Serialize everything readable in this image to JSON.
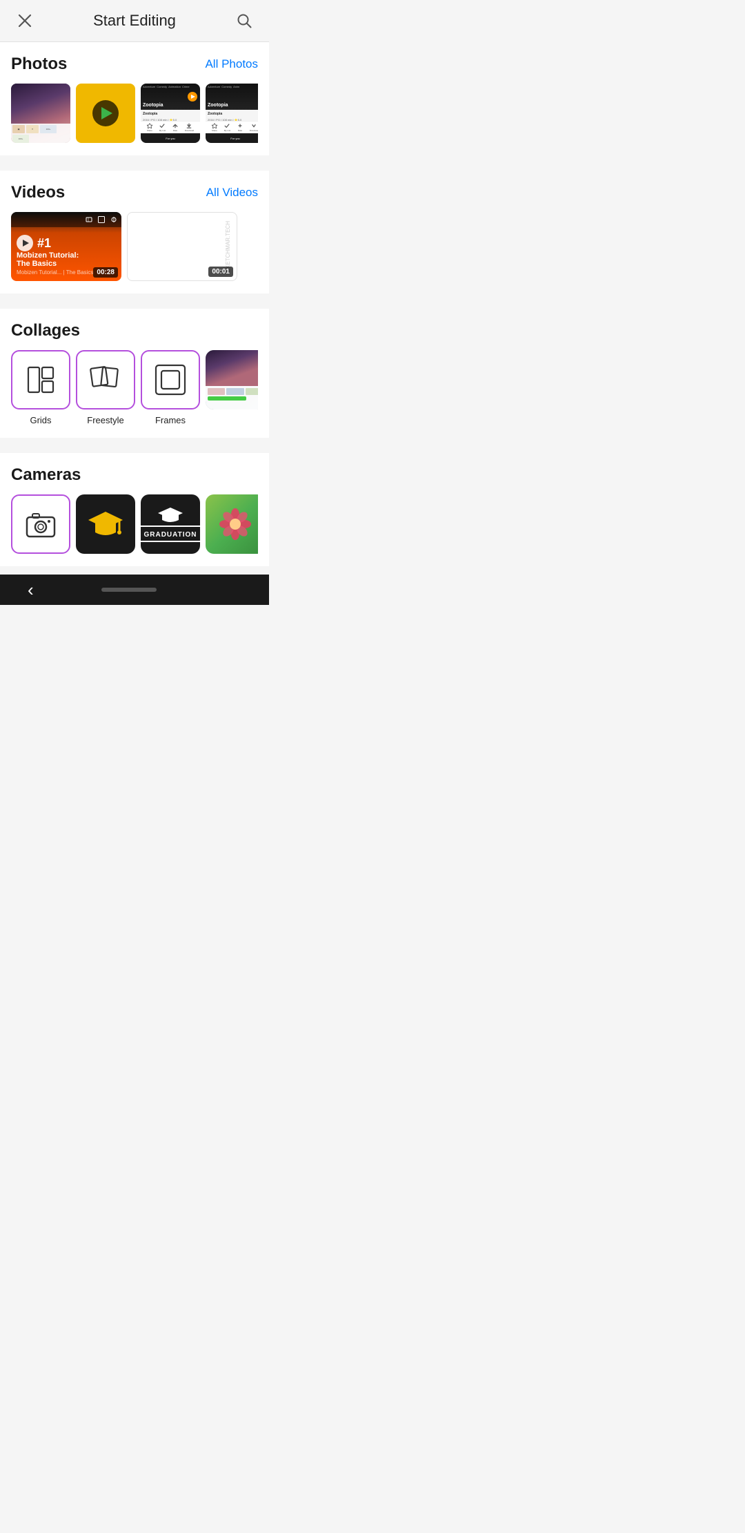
{
  "header": {
    "title": "Start Editing",
    "close_label": "✕",
    "search_label": "⌕"
  },
  "photos": {
    "section_title": "Photos",
    "all_link": "All Photos",
    "items": [
      {
        "id": "photo-1",
        "type": "image",
        "description": "dark portrait"
      },
      {
        "id": "photo-2",
        "type": "video_thumb",
        "description": "yellow play"
      },
      {
        "id": "photo-3",
        "type": "zootopia",
        "description": "Zootopia screenshot"
      },
      {
        "id": "photo-4",
        "type": "zootopia2",
        "description": "Zootopia screenshot 2"
      }
    ]
  },
  "videos": {
    "section_title": "Videos",
    "all_link": "All Videos",
    "items": [
      {
        "id": "video-1",
        "duration": "00:28",
        "title": "The Basics",
        "num": "#1"
      },
      {
        "id": "video-2",
        "duration": "00:01",
        "watermark": "SKETCHMAR.TECH"
      }
    ]
  },
  "collages": {
    "section_title": "Collages",
    "items": [
      {
        "id": "grids",
        "label": "Grids",
        "icon": "grid"
      },
      {
        "id": "freestyle",
        "label": "Freestyle",
        "icon": "freestyle"
      },
      {
        "id": "frames",
        "label": "Frames",
        "icon": "frames"
      },
      {
        "id": "photo",
        "label": "",
        "icon": "photo"
      }
    ]
  },
  "cameras": {
    "section_title": "Cameras",
    "items": [
      {
        "id": "camera-1",
        "icon": "camera",
        "bg": "white"
      },
      {
        "id": "camera-2",
        "icon": "graduation",
        "bg": "dark"
      },
      {
        "id": "camera-3",
        "icon": "graduation-text",
        "bg": "dark"
      },
      {
        "id": "camera-4",
        "icon": "flower",
        "bg": "green"
      }
    ]
  },
  "bottom_nav": {
    "back_label": "‹"
  }
}
